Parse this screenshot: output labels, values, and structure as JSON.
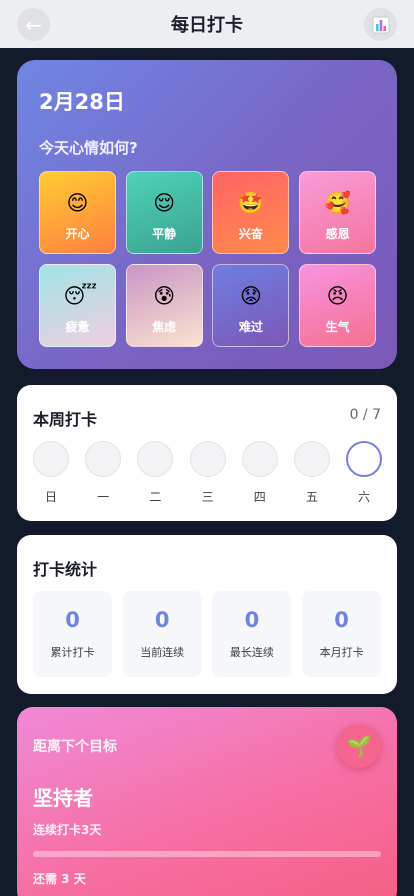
{
  "header": {
    "title": "每日打卡",
    "back_icon": "back-arrow-icon",
    "stats_icon": "bar-chart-icon"
  },
  "mood": {
    "date": "2月28日",
    "question": "今天心情如何?",
    "options": [
      {
        "label": "开心",
        "emoji": "😊",
        "icon": "smiling-face-icon",
        "gradient": [
          "#ffcc33",
          "#ff7f3f"
        ]
      },
      {
        "label": "平静",
        "emoji": "😌",
        "icon": "relieved-face-icon",
        "gradient": [
          "#4fd2b8",
          "#3aa391"
        ]
      },
      {
        "label": "兴奋",
        "emoji": "🤩",
        "icon": "star-struck-face-icon",
        "gradient": [
          "#ff6464",
          "#ff8a4c"
        ]
      },
      {
        "label": "感恩",
        "emoji": "🥰",
        "icon": "smiling-hearts-face-icon",
        "gradient": [
          "#f99bd8",
          "#f5749e"
        ]
      },
      {
        "label": "疲惫",
        "emoji": "😴",
        "icon": "sleeping-face-icon",
        "gradient": [
          "#9fe3e6",
          "#f0cfe0"
        ]
      },
      {
        "label": "焦虑",
        "emoji": "😰",
        "icon": "anxious-face-icon",
        "gradient": [
          "#c995c6",
          "#fae3cf"
        ]
      },
      {
        "label": "难过",
        "emoji": "😟",
        "icon": "worried-face-icon",
        "gradient": [
          "#6f7ee0",
          "#7b58b6"
        ]
      },
      {
        "label": "生气",
        "emoji": "😠",
        "icon": "angry-face-icon",
        "gradient": [
          "#f893e0",
          "#f5708f"
        ]
      }
    ]
  },
  "week": {
    "title": "本周打卡",
    "count": "0 / 7",
    "days": [
      {
        "label": "日",
        "today": false
      },
      {
        "label": "一",
        "today": false
      },
      {
        "label": "二",
        "today": false
      },
      {
        "label": "三",
        "today": false
      },
      {
        "label": "四",
        "today": false
      },
      {
        "label": "五",
        "today": false
      },
      {
        "label": "六",
        "today": true
      }
    ]
  },
  "stats": {
    "title": "打卡统计",
    "items": [
      {
        "value": "0",
        "label": "累计打卡"
      },
      {
        "value": "0",
        "label": "当前连续"
      },
      {
        "value": "0",
        "label": "最长连续"
      },
      {
        "value": "0",
        "label": "本月打卡"
      }
    ]
  },
  "goal": {
    "kicker": "距离下个目标",
    "name": "坚持者",
    "description": "连续打卡3天",
    "progress_fraction": 0,
    "remaining": "还需 3 天",
    "badge_emoji": "🌱",
    "badge_icon": "seedling-icon"
  }
}
